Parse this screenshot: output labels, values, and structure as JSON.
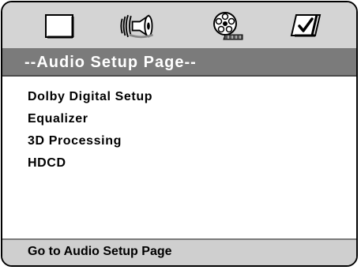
{
  "toolbar": {
    "icons": [
      "general-setup-icon",
      "audio-speaker-icon",
      "video-film-reel-icon",
      "preferences-check-icon"
    ]
  },
  "header": {
    "title": "--Audio Setup Page--"
  },
  "menu": {
    "items": [
      {
        "label": "Dolby Digital Setup"
      },
      {
        "label": "Equalizer"
      },
      {
        "label": "3D Processing"
      },
      {
        "label": "HDCD"
      }
    ]
  },
  "status": {
    "text": "Go to Audio Setup Page"
  },
  "colors": {
    "toolbar_bg": "#d4d4d4",
    "title_bg": "#7b7b7b",
    "title_text": "#ffffff",
    "status_bg": "#cfcfcf"
  }
}
